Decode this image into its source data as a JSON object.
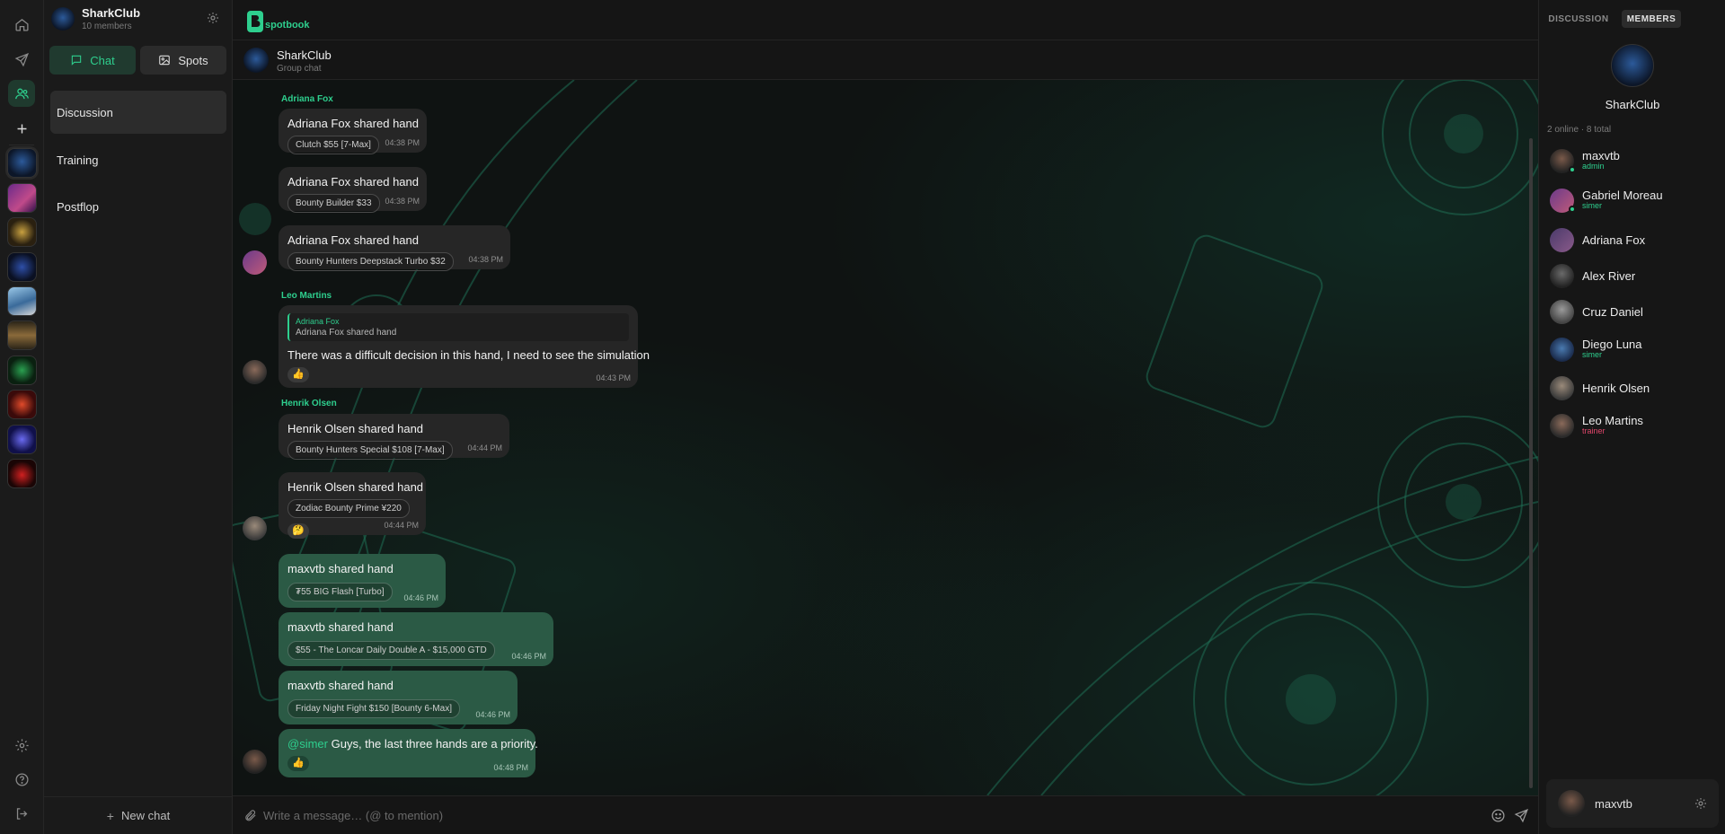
{
  "app": {
    "brand": "spotbook"
  },
  "colors": {
    "accent": "#2ecf8e",
    "own_bubble": "#2b5a45",
    "other_bubble": "#262626",
    "trainer": "#e0456a"
  },
  "rail": {
    "icons": [
      "home-icon",
      "send-icon",
      "users-icon",
      "plus-icon"
    ],
    "bottom_icons": [
      "settings-icon",
      "help-icon",
      "logout-icon"
    ]
  },
  "sidebar": {
    "group_name": "SharkClub",
    "member_count": "10 members",
    "tabs": {
      "chat": "Chat",
      "spots": "Spots"
    },
    "channels": [
      {
        "label": "Discussion"
      },
      {
        "label": "Training"
      },
      {
        "label": "Postflop"
      }
    ],
    "new_chat": "New chat"
  },
  "chat": {
    "title": "SharkClub",
    "subtitle": "Group chat",
    "composer_placeholder": "Write a message… (@ to mention)",
    "messages": [
      {
        "sender": "Adriana Fox",
        "title": "Adriana Fox shared hand",
        "chip": "Clutch $55 [7-Max]",
        "time": "04:38 PM"
      },
      {
        "title": "Adriana Fox shared hand",
        "chip": "Bounty Builder $33",
        "time": "04:38 PM"
      },
      {
        "title": "Adriana Fox shared hand",
        "chip": "Bounty Hunters Deepstack Turbo $32",
        "time": "04:38 PM"
      },
      {
        "sender": "Leo Martins",
        "quote_name": "Adriana Fox",
        "quote_text": "Adriana Fox shared hand",
        "text": "There was a difficult decision in this hand, I need to see the simulation",
        "reaction": "👍",
        "time": "04:43 PM"
      },
      {
        "sender": "Henrik Olsen",
        "title": "Henrik Olsen shared hand",
        "chip": "Bounty Hunters Special $108 [7-Max]",
        "time": "04:44 PM"
      },
      {
        "title": "Henrik Olsen shared hand",
        "chip": "Zodiac Bounty Prime ¥220",
        "reaction": "🤔",
        "time": "04:44 PM"
      },
      {
        "title": "maxvtb shared hand",
        "chip": "₮55 BIG Flash [Turbo]",
        "time": "04:46 PM"
      },
      {
        "title": "maxvtb shared hand",
        "chip": "$55 - The Loncar Daily Double A - $15,000 GTD",
        "time": "04:46 PM"
      },
      {
        "title": "maxvtb shared hand",
        "chip": "Friday Night Fight $150 [Bounty 6-Max]",
        "time": "04:46 PM"
      },
      {
        "mention": "@simer",
        "text": "Guys, the last three hands are a priority.",
        "reaction": "👍",
        "time": "04:48 PM"
      }
    ]
  },
  "members_panel": {
    "tabs": {
      "discussion": "DISCUSSION",
      "members": "MEMBERS"
    },
    "group_name": "SharkClub",
    "counts": "2 online · 8 total",
    "members": [
      {
        "name": "maxvtb",
        "role": "admin",
        "online": true
      },
      {
        "name": "Gabriel Moreau",
        "role": "simer",
        "online": true
      },
      {
        "name": "Adriana Fox",
        "role": ""
      },
      {
        "name": "Alex River",
        "role": ""
      },
      {
        "name": "Cruz Daniel",
        "role": ""
      },
      {
        "name": "Diego Luna",
        "role": "simer"
      },
      {
        "name": "Henrik Olsen",
        "role": ""
      },
      {
        "name": "Leo Martins",
        "role": "trainer"
      }
    ],
    "current_user": "maxvtb"
  }
}
